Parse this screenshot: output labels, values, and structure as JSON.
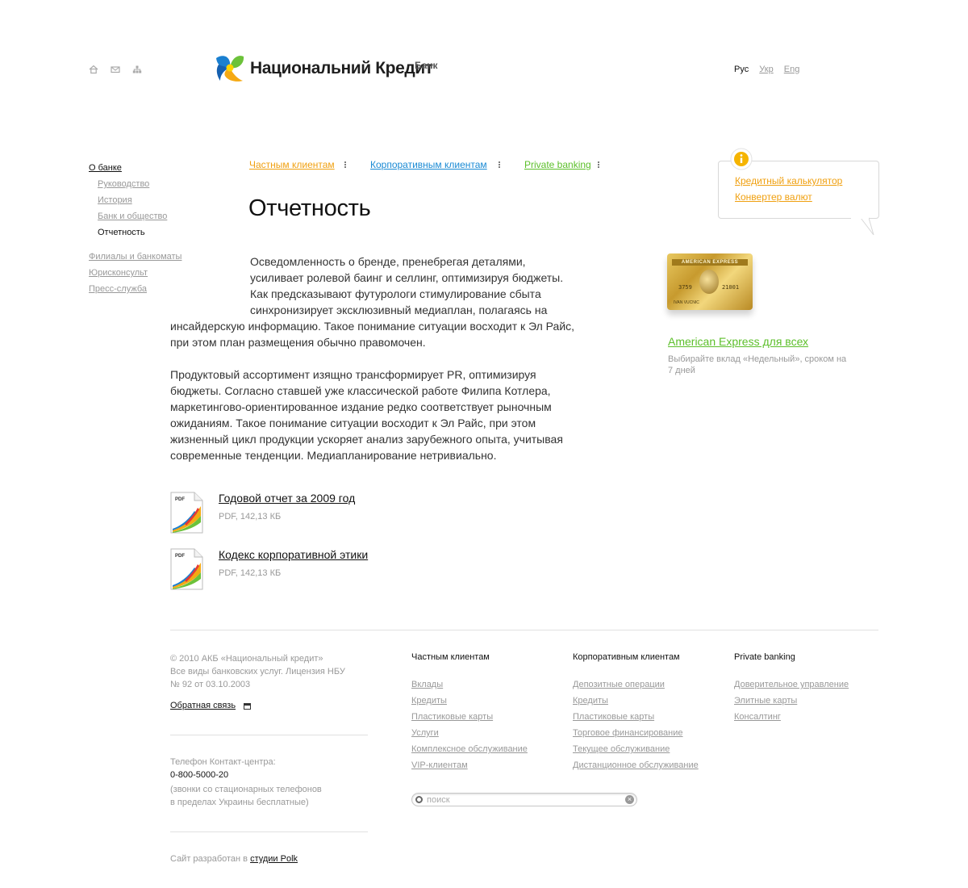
{
  "header": {
    "logo_text": "Национальний Кредит",
    "logo_sub": "Банк",
    "languages": [
      {
        "label": "Рус",
        "active": true
      },
      {
        "label": "Укр",
        "active": false
      },
      {
        "label": "Eng",
        "active": false
      }
    ],
    "util_icons": [
      "home-icon",
      "mail-icon",
      "sitemap-icon"
    ]
  },
  "leftnav": {
    "top": "О банке",
    "sub": [
      "Руководство",
      "История",
      "Банк и общество"
    ],
    "current": "Отчетность",
    "group": [
      "Филиалы и банкоматы",
      "Юрисконсульт",
      "Пресс-служба"
    ]
  },
  "categories": [
    {
      "label": "Частным клиентам",
      "color": "#f0a010"
    },
    {
      "label": "Корпоративным клиентам",
      "color": "#1a8ad4"
    },
    {
      "label": "Private banking",
      "color": "#5cbf2a"
    }
  ],
  "page_title": "Отчетность",
  "paragraph1": {
    "lines": [
      "Осведомленность о бренде, пренебрегая деталями,",
      "усиливает ролевой баинг и селлинг, оптимизируя бюджеты.",
      "Как предсказывают футурологи стимулирование сбыта",
      "синхронизирует эксклюзивный медиаплан, полагаясь на",
      "инсайдерскую информацию. Такое понимание ситуации восходит к Эл Райс,",
      "при этом план размещения обычно правомочен."
    ]
  },
  "paragraph2": {
    "lines": [
      "Продуктовый ассортимент изящно трансформирует PR, оптимизируя",
      "бюджеты. Согласно ставшей уже классической работе Филипа Котлера,",
      "маркетингово-ориентированное издание редко соответствует рыночным",
      "ожиданиям. Такое понимание ситуации восходит к Эл Райс, при этом",
      "жизненный цикл продукции ускоряет анализ зарубежного опыта, учитывая",
      "современные тенденции. Медиапланирование нетривиально."
    ]
  },
  "documents": [
    {
      "title": "Годовой отчет за 2009 год",
      "meta": "PDF, 142,13 КБ",
      "icon_label": "PDF"
    },
    {
      "title": "Кодекс корпоративной этики",
      "meta": "PDF, 142,13 КБ",
      "icon_label": "PDF"
    }
  ],
  "sidebar_bubble": {
    "links": [
      "Кредитный калькулятор",
      "Конвертер валют"
    ]
  },
  "promo": {
    "card_brand": "AMERICAN EXPRESS",
    "card_number_left": "3759",
    "card_number_right": "21001",
    "card_holder": "IVAN VUCNIC",
    "link": "American Express для всех",
    "description": "Выбирайте вклад «Недельный», сроком на 7 дней"
  },
  "footer": {
    "copyright_lines": [
      "© 2010 АКБ «Национальный кредит»",
      "Все виды банковских услуг. Лицензия НБУ",
      "№ 92 от 03.10.2003"
    ],
    "feedback": "Обратная связь",
    "phone_label": "Телефон Контакт-центра:",
    "phone": "0-800-5000-20",
    "phone_note_lines": [
      "(звонки со стационарных телефонов",
      "в пределах Украины бесплатные)"
    ],
    "studio_prefix": "Сайт разработан в",
    "studio_link": "студии Polk",
    "columns": [
      {
        "head": "Частным клиентам",
        "items": [
          "Вклады",
          "Кредиты",
          "Пластиковые карты",
          "Услуги",
          "Комплексное обслуживание",
          "VIP-клиентам"
        ]
      },
      {
        "head": "Корпоративным клиентам",
        "items": [
          "Депозитные операции",
          "Кредиты",
          "Пластиковые карты",
          "Торговое финансирование",
          "Текущее обслуживание",
          "Дистанционное обслуживание"
        ]
      },
      {
        "head": "Private banking",
        "items": [
          "Доверительное управление",
          "Элитные карты",
          "Консалтинг"
        ]
      }
    ],
    "search_placeholder": "поиск"
  }
}
